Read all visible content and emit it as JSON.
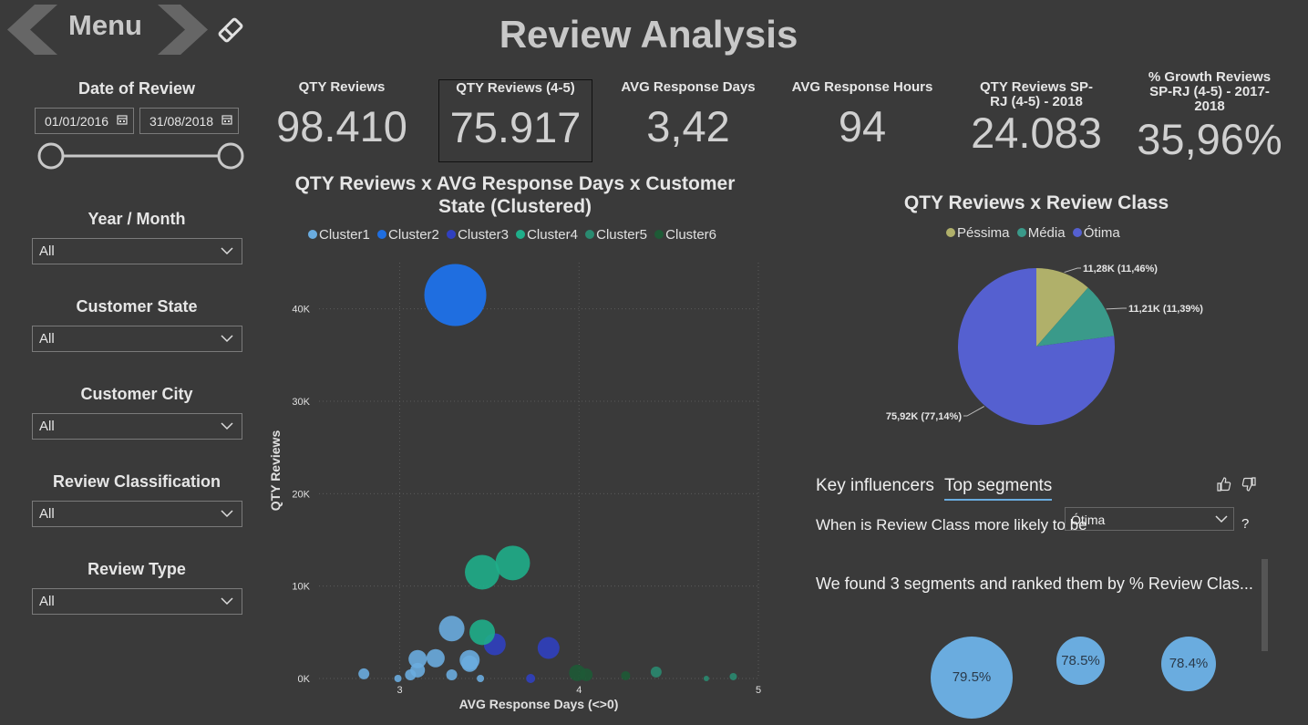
{
  "header": {
    "menu_label": "Menu",
    "title": "Review Analysis"
  },
  "slicers": {
    "date": {
      "title": "Date of Review",
      "start": "01/01/2016",
      "end": "31/08/2018"
    },
    "year_month": {
      "title": "Year / Month",
      "value": "All"
    },
    "customer_state": {
      "title": "Customer State",
      "value": "All"
    },
    "customer_city": {
      "title": "Customer City",
      "value": "All"
    },
    "review_classification": {
      "title": "Review Classification",
      "value": "All"
    },
    "review_type": {
      "title": "Review Type",
      "value": "All"
    }
  },
  "kpis": [
    {
      "label": "QTY Reviews",
      "value": "98.410"
    },
    {
      "label": "QTY Reviews (4-5)",
      "value": "75.917"
    },
    {
      "label": "AVG Response Days",
      "value": "3,42"
    },
    {
      "label": "AVG Response Hours",
      "value": "94"
    },
    {
      "label": "QTY Reviews SP-RJ (4-5) - 2018",
      "value": "24.083"
    },
    {
      "label": "% Growth Reviews SP-RJ (4-5) - 2017-2018",
      "value": "35,96%"
    }
  ],
  "colors": {
    "background": "#3a3a3a",
    "cluster1": "#6aacdf",
    "cluster2": "#1f6ee0",
    "cluster3": "#3040c0",
    "cluster4": "#1fae8a",
    "cluster5": "#2a8a70",
    "cluster6": "#1e5a36",
    "pessima": "#b0b06a",
    "media": "#3a9a8a",
    "otima": "#5560d0",
    "segment": "#6aacdf"
  },
  "chart_data": [
    {
      "type": "scatter",
      "title": "QTY Reviews x AVG Response Days x Customer State (Clustered)",
      "xlabel": "AVG Response Days (<>0)",
      "ylabel": "QTY Reviews",
      "xlim": [
        2.55,
        5
      ],
      "ylim": [
        0,
        45000
      ],
      "x_ticks": [
        3,
        4,
        5
      ],
      "y_ticks": [
        0,
        10000,
        20000,
        30000,
        40000
      ],
      "y_tick_labels": [
        "0K",
        "10K",
        "20K",
        "30K",
        "40K"
      ],
      "grid": true,
      "legend_position": "top",
      "series": [
        {
          "name": "Cluster1",
          "points": [
            {
              "x": 2.8,
              "y": 500,
              "size": 6
            },
            {
              "x": 2.99,
              "y": 0,
              "size": 4
            },
            {
              "x": 3.06,
              "y": 400,
              "size": 6
            },
            {
              "x": 3.1,
              "y": 900,
              "size": 8
            },
            {
              "x": 3.1,
              "y": 2100,
              "size": 10
            },
            {
              "x": 3.2,
              "y": 2200,
              "size": 10
            },
            {
              "x": 3.29,
              "y": 400,
              "size": 6
            },
            {
              "x": 3.29,
              "y": 5400,
              "size": 14
            },
            {
              "x": 3.39,
              "y": 2000,
              "size": 11
            },
            {
              "x": 3.39,
              "y": 1600,
              "size": 9
            },
            {
              "x": 3.45,
              "y": 0,
              "size": 4
            }
          ]
        },
        {
          "name": "Cluster2",
          "points": [
            {
              "x": 3.31,
              "y": 41500,
              "size": 34
            }
          ]
        },
        {
          "name": "Cluster3",
          "points": [
            {
              "x": 3.53,
              "y": 3700,
              "size": 12
            },
            {
              "x": 3.83,
              "y": 3300,
              "size": 12
            },
            {
              "x": 3.73,
              "y": 0,
              "size": 5
            }
          ]
        },
        {
          "name": "Cluster4",
          "points": [
            {
              "x": 3.46,
              "y": 5000,
              "size": 14
            },
            {
              "x": 3.46,
              "y": 11500,
              "size": 19
            },
            {
              "x": 3.63,
              "y": 12500,
              "size": 19
            }
          ]
        },
        {
          "name": "Cluster5",
          "points": [
            {
              "x": 4.43,
              "y": 700,
              "size": 6
            },
            {
              "x": 4.86,
              "y": 200,
              "size": 4
            },
            {
              "x": 4.71,
              "y": 0,
              "size": 3
            }
          ]
        },
        {
          "name": "Cluster6",
          "points": [
            {
              "x": 3.99,
              "y": 600,
              "size": 9
            },
            {
              "x": 4.04,
              "y": 400,
              "size": 7
            },
            {
              "x": 4.26,
              "y": 300,
              "size": 5
            }
          ]
        }
      ]
    },
    {
      "type": "pie",
      "title": "QTY Reviews x Review Class",
      "legend_position": "top",
      "slices": [
        {
          "name": "Péssima",
          "value": 11.28,
          "label": "11,28K (11,46%)"
        },
        {
          "name": "Média",
          "value": 11.21,
          "label": "11,21K (11,39%)"
        },
        {
          "name": "Ótima",
          "value": 75.92,
          "label": "75,92K (77,14%)"
        }
      ]
    }
  ],
  "influencers": {
    "tabs": [
      "Key influencers",
      "Top segments"
    ],
    "active_tab": "Top segments",
    "question": "When is Review Class more likely to be",
    "question_mark": "?",
    "selected_value": "Ótima",
    "found_text": "We found 3 segments and ranked them by % Review Clas...",
    "segments": [
      "79.5%",
      "78.5%",
      "78.4%"
    ]
  }
}
